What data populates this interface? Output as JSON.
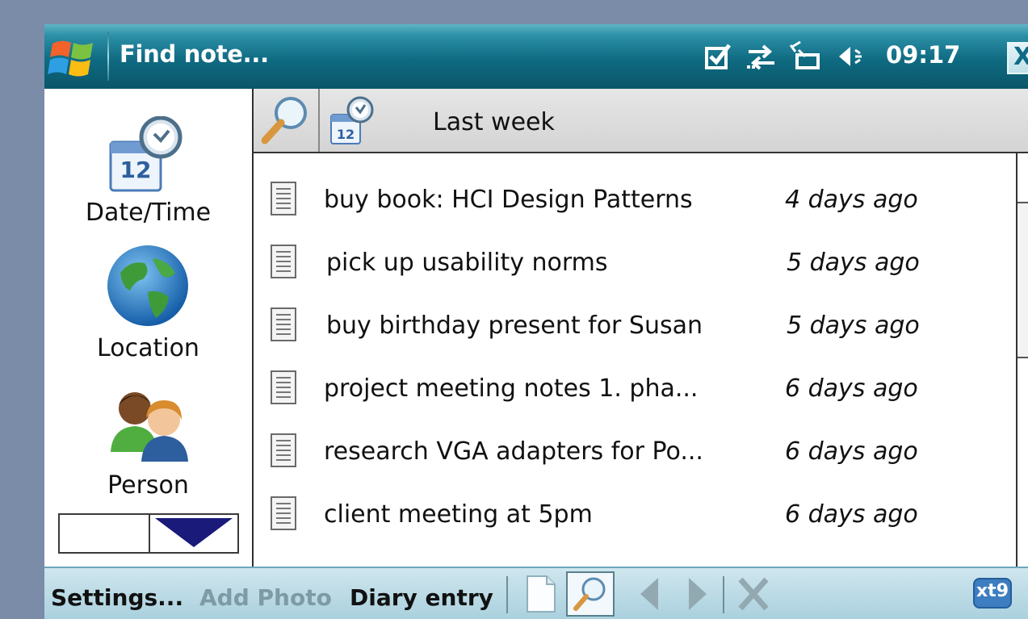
{
  "titlebar": {
    "title": "Find note...",
    "clock": "09:17",
    "close_label": "X"
  },
  "filters": {
    "items": [
      {
        "label": "Date/Time",
        "icon": "calendar-clock-icon"
      },
      {
        "label": "Location",
        "icon": "globe-icon"
      },
      {
        "label": "Person",
        "icon": "people-icon"
      }
    ]
  },
  "filter_bar": {
    "active_filter": "Last week"
  },
  "notes": [
    {
      "title": "buy book: HCI Design Patterns",
      "date": "4 days ago"
    },
    {
      "title": "pick up usability norms",
      "date": "5 days ago"
    },
    {
      "title": "buy birthday present for Susan",
      "date": "5 days ago"
    },
    {
      "title": "project meeting notes 1. pha...",
      "date": "6 days ago"
    },
    {
      "title": "research VGA adapters for Po...",
      "date": "6 days ago"
    },
    {
      "title": "client meeting at 5pm",
      "date": "6 days ago"
    }
  ],
  "menubar": {
    "settings": "Settings...",
    "add_photo": "Add Photo",
    "diary_entry": "Diary entry",
    "input_method": "xt9"
  },
  "colors": {
    "titlebar": "#0f6b82",
    "menubar": "#a9d0dd",
    "disabled_text": "#7d9aa5",
    "arrow_blue": "#1a1a7a"
  }
}
